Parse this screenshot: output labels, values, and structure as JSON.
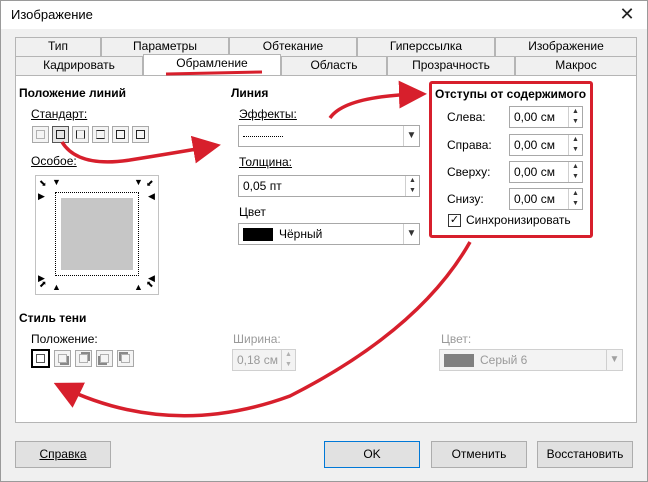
{
  "window": {
    "title": "Изображение"
  },
  "tabs_row1": [
    "Тип",
    "Параметры",
    "Обтекание",
    "Гиперссылка",
    "Изображение"
  ],
  "tabs_row2": [
    "Кадрировать",
    "Обрамление",
    "Область",
    "Прозрачность",
    "Макрос"
  ],
  "line_arrangement": {
    "title": "Положение линий",
    "standard_label": "Стандарт:",
    "custom_label": "Особое:"
  },
  "line": {
    "title": "Линия",
    "effects_label": "Эффекты:",
    "width_label": "Толщина:",
    "width_value": "0,05 пт",
    "color_label": "Цвет",
    "color_value": "Чёрный",
    "color_hex": "#000000"
  },
  "padding": {
    "title": "Отступы от содержимого",
    "left_label": "Слева:",
    "left_value": "0,00 см",
    "right_label": "Справа:",
    "right_value": "0,00 см",
    "top_label": "Сверху:",
    "top_value": "0,00 см",
    "bottom_label": "Снизу:",
    "bottom_value": "0,00 см",
    "sync_label": "Синхронизировать",
    "sync_checked": "✓"
  },
  "shadow": {
    "title": "Стиль тени",
    "position_label": "Положение:",
    "width_label": "Ширина:",
    "width_value": "0,18 см",
    "color_label": "Цвет:",
    "color_value": "Серый 6",
    "color_hex": "#808080"
  },
  "buttons": {
    "help": "Справка",
    "ok": "OK",
    "cancel": "Отменить",
    "reset": "Восстановить"
  },
  "annotation_color": "#d71f2c"
}
